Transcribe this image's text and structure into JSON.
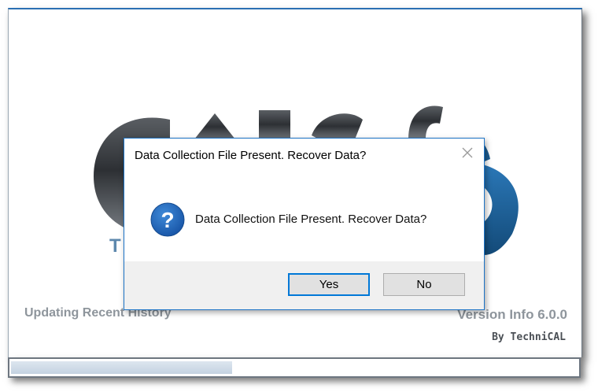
{
  "splash": {
    "logo_text": "CALC",
    "status": "Updating Recent History",
    "version": "Version Info 6.0.0",
    "byline": "By TechniCAL",
    "progress": 0.39
  },
  "dialog": {
    "title": "Data Collection File Present.  Recover Data?",
    "message": "Data Collection File Present.  Recover Data?",
    "icon": "question-icon",
    "buttons": {
      "yes": "Yes",
      "no": "No"
    }
  },
  "colors": {
    "accent": "#0078d7",
    "icon_blue": "#1e63b8",
    "logo_gray": "#3c3f43",
    "logo_blue": "#1c5d93"
  }
}
